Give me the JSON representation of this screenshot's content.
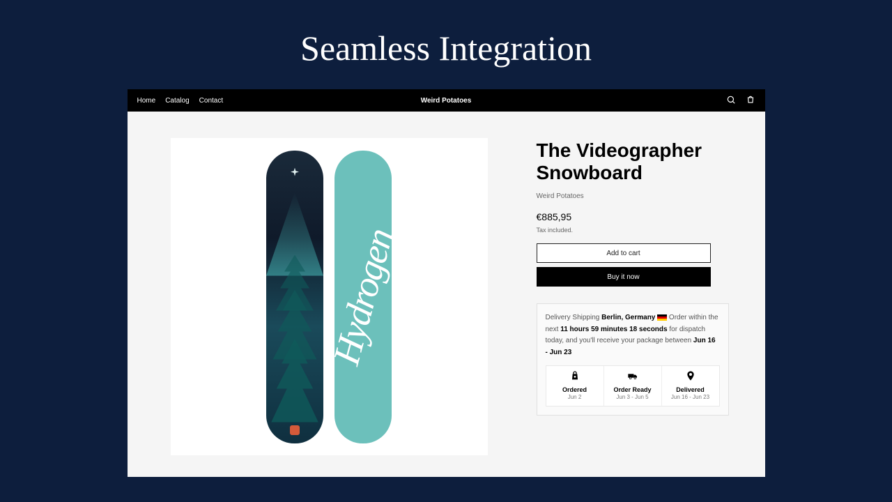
{
  "hero": "Seamless Integration",
  "topbar": {
    "nav": [
      "Home",
      "Catalog",
      "Contact"
    ],
    "brand": "Weird Potatoes"
  },
  "product": {
    "title": "The Videographer Snowboard",
    "vendor": "Weird Potatoes",
    "price": "€885,95",
    "tax_note": "Tax included.",
    "back_word": "Hydrogen"
  },
  "buttons": {
    "add": "Add to cart",
    "buy": "Buy it now"
  },
  "shipping": {
    "prefix": "Delivery Shipping ",
    "location": "Berlin, Germany",
    "after_loc": " Order within the next ",
    "countdown": "11 hours 59 minutes 18 seconds",
    "mid": " for dispatch today, and you'll receive your package between ",
    "range": "Jun 16 - Jun 23",
    "steps": [
      {
        "label": "Ordered",
        "date": "Jun 2"
      },
      {
        "label": "Order Ready",
        "date": "Jun 3 - Jun 5"
      },
      {
        "label": "Delivered",
        "date": "Jun 16 - Jun 23"
      }
    ]
  }
}
